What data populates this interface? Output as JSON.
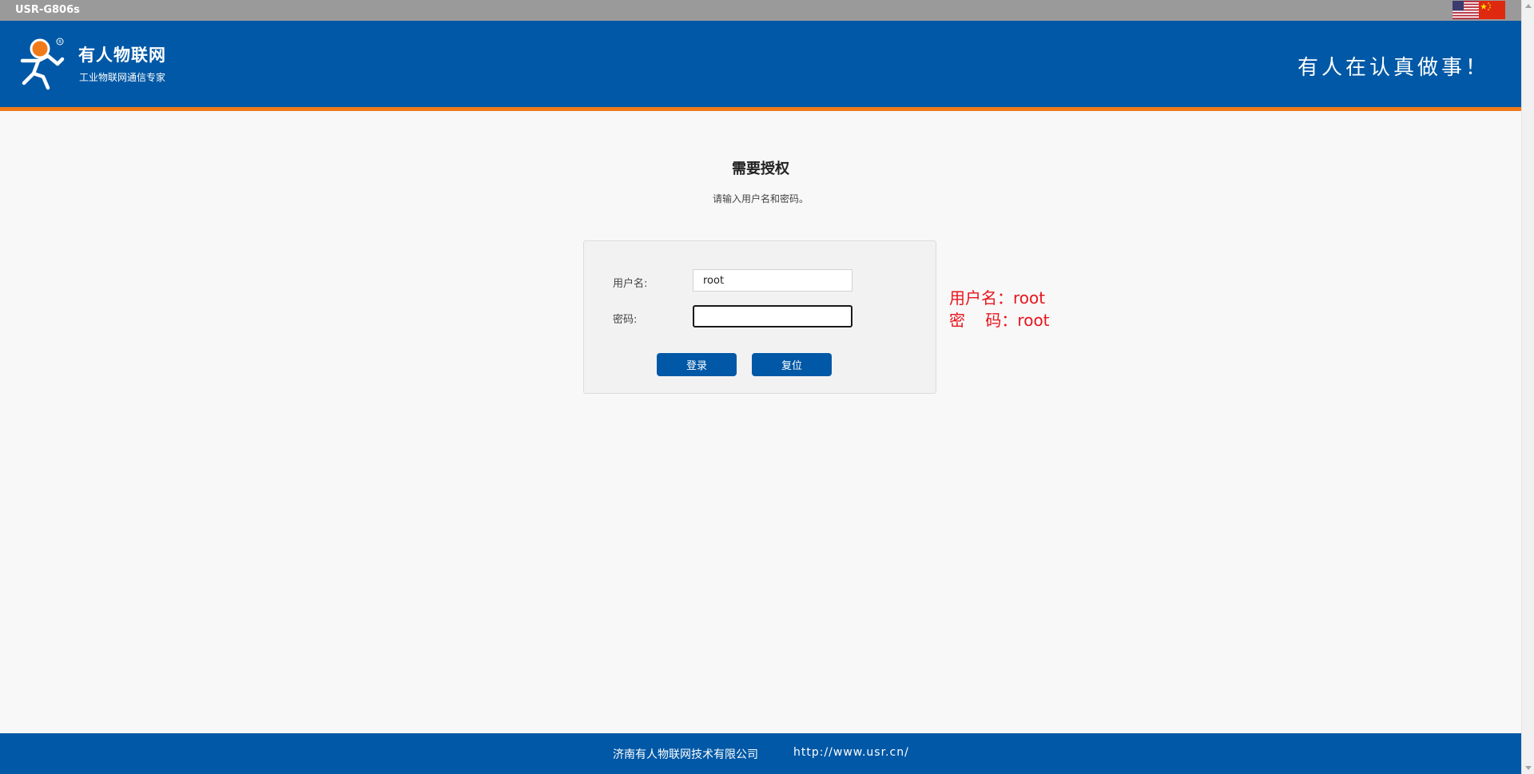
{
  "topbar": {
    "device_name": "USR-G806s",
    "languages": [
      {
        "icon": "us-flag-icon",
        "name": "English"
      },
      {
        "icon": "cn-flag-icon",
        "name": "中文"
      }
    ]
  },
  "header": {
    "brand_name": "有人物联网",
    "brand_tagline": "工业物联网通信专家",
    "slogan": "有人在认真做事！",
    "colors": {
      "primary": "#0058a6",
      "accent": "#f07a1a"
    }
  },
  "main": {
    "title": "需要授权",
    "subtitle": "请输入用户名和密码。",
    "form": {
      "username_label": "用户名:",
      "username_value": "root",
      "password_label": "密码:",
      "password_value": "",
      "login_label": "登录",
      "reset_label": "复位"
    },
    "hint": {
      "line1": "用户名：root",
      "line2": "密    码：root",
      "color": "#e8141c"
    }
  },
  "footer": {
    "company": "济南有人物联网技术有限公司",
    "url": "http://www.usr.cn/"
  }
}
